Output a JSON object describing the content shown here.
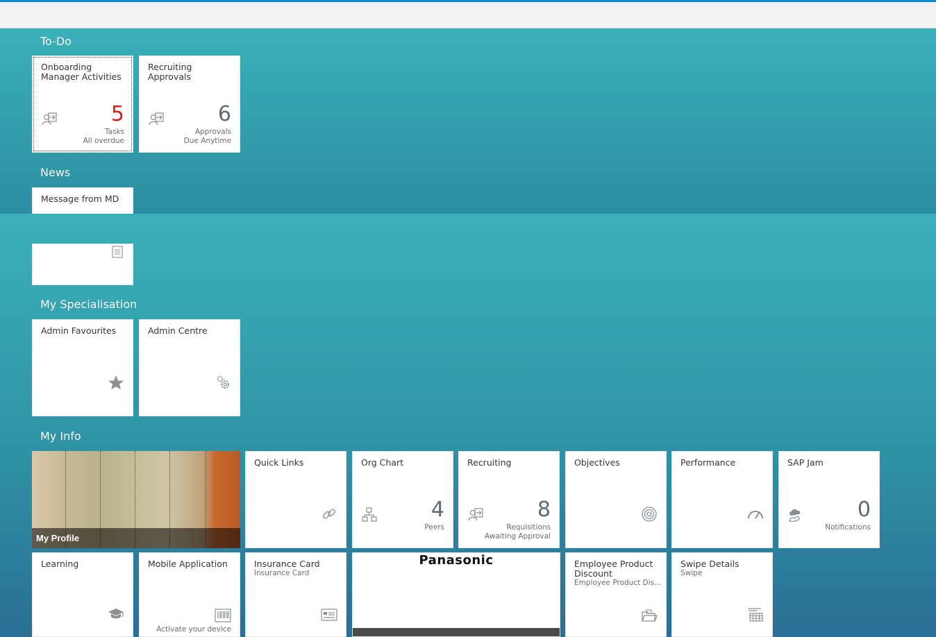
{
  "sections": {
    "todo": "To-Do",
    "news": "News",
    "specialisation": "My Specialisation",
    "myinfo": "My Info"
  },
  "todo_tiles": [
    {
      "title": "Onboarding Manager Activities",
      "value": "5",
      "footer1": "Tasks",
      "footer2": "All overdue",
      "icon": "person-arrow-icon",
      "value_color": "#d0221a"
    },
    {
      "title": "Recruiting Approvals",
      "value": "6",
      "footer1": "Approvals",
      "footer2": "Due Anytime",
      "icon": "person-arrow-icon"
    }
  ],
  "news_tiles": [
    {
      "title": "Message from MD",
      "icon": "document-icon"
    }
  ],
  "specialisation_tiles": [
    {
      "title": "Admin Favourites",
      "icon": "star-icon"
    },
    {
      "title": "Admin Centre",
      "icon": "gears-icon"
    }
  ],
  "myinfo": {
    "profile": {
      "label": "My Profile"
    },
    "quick_links": {
      "title": "Quick Links",
      "icon": "link-icon"
    },
    "org_chart": {
      "title": "Org Chart",
      "value": "4",
      "footer": "Peers",
      "icon": "org-chart-icon"
    },
    "recruiting": {
      "title": "Recruiting",
      "value": "8",
      "footer1": "Requisitions",
      "footer2": "Awaiting Approval",
      "icon": "person-arrow-icon"
    },
    "objectives": {
      "title": "Objectives",
      "icon": "target-icon"
    },
    "performance": {
      "title": "Performance",
      "icon": "gauge-icon"
    },
    "sap_jam": {
      "title": "SAP Jam",
      "value": "0",
      "footer": "Notifications",
      "icon": "jam-cloud-icon"
    },
    "learning": {
      "title": "Learning",
      "icon": "graduation-cap-icon"
    },
    "mobile_app": {
      "title": "Mobile Application",
      "footer": "Activate your device",
      "icon": "barcode-icon"
    },
    "insurance": {
      "title": "Insurance Card",
      "subtitle": "Insurance Card",
      "icon": "card-icon"
    },
    "panasonic": {
      "logo": "Panasonic"
    },
    "discount": {
      "title": "Employee Product Discount",
      "subtitle": "Employee Product Dis...",
      "icon": "folder-icon"
    },
    "swipe": {
      "title": "Swipe Details",
      "subtitle": "Swipe",
      "icon": "grid-list-icon"
    }
  },
  "colors": {
    "accent_top": "#0a8bd6",
    "kpi_alert": "#d0221a",
    "icon_gray": "#8a8f94"
  }
}
